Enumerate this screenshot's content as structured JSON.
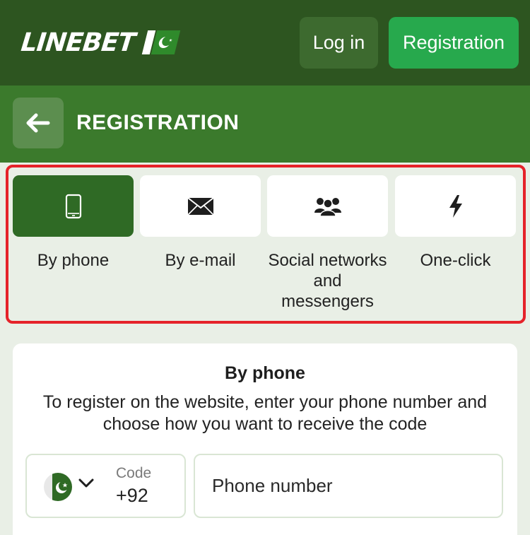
{
  "header": {
    "logo_text": "LINEBET",
    "login_label": "Log in",
    "registration_label": "Registration"
  },
  "titlebar": {
    "title": "REGISTRATION"
  },
  "methods": [
    {
      "label": "By phone",
      "icon": "phone-icon",
      "active": true
    },
    {
      "label": "By e-mail",
      "icon": "envelope-icon",
      "active": false
    },
    {
      "label": "Social networks and messengers",
      "icon": "users-icon",
      "active": false
    },
    {
      "label": "One-click",
      "icon": "lightning-icon",
      "active": false
    }
  ],
  "form": {
    "title": "By phone",
    "description": "To register on the website, enter your phone number and choose how you want to receive the code",
    "code_label": "Code",
    "code_value": "+92",
    "phone_placeholder": "Phone number"
  },
  "colors": {
    "header_bg": "#2d5520",
    "titlebar_bg": "#3b7a2c",
    "accent_green": "#27a94d",
    "active_tile": "#2f6a25",
    "highlight_red": "#e5232a"
  }
}
